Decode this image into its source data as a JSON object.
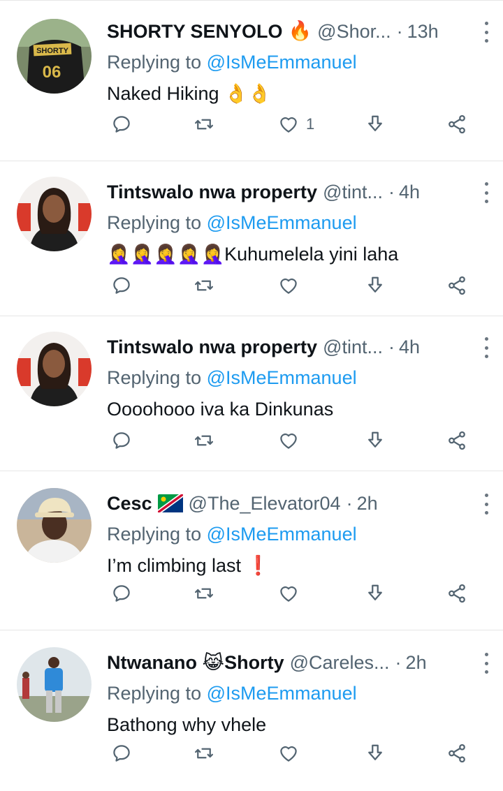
{
  "reply_prefix": "Replying to",
  "tweets": [
    {
      "name": "SHORTY SENYOLO",
      "name_emoji": "🔥",
      "handle": "@Shor...",
      "dot": "·",
      "time": "13h",
      "reply_to": "@IsMeEmmanuel",
      "text": "Naked Hiking ",
      "text_emoji": "👌👌",
      "like_count": "1",
      "avatar_text": "SHORTY",
      "avatar_number": "06"
    },
    {
      "name": "Tintswalo nwa property",
      "handle": "@tint...",
      "dot": "·",
      "time": "4h",
      "reply_to": "@IsMeEmmanuel",
      "text_emoji": "🤦‍♀️🤦‍♀️🤦‍♀️🤦‍♀️🤦‍♀️",
      "text": "Kuhumelela yini laha",
      "like_count": ""
    },
    {
      "name": "Tintswalo nwa property",
      "handle": "@tint...",
      "dot": "·",
      "time": "4h",
      "reply_to": "@IsMeEmmanuel",
      "text": "Oooohooo iva ka Dinkunas",
      "like_count": ""
    },
    {
      "name": "Cesc",
      "name_flag": "namibia-flag",
      "handle": "@The_Elevator04",
      "dot": "·",
      "time": "2h",
      "reply_to": "@IsMeEmmanuel",
      "text": "I’m climbing last ",
      "text_emoji": "❗",
      "like_count": ""
    },
    {
      "name": "Ntwanano ",
      "name_emoji": "😹",
      "name_suffix": "Shorty",
      "handle": "@Careles...",
      "dot": "·",
      "time": "2h",
      "reply_to": "@IsMeEmmanuel",
      "text": "Bathong why vhele",
      "like_count": ""
    }
  ],
  "colors": {
    "link": "#1d9bf0",
    "secondary": "#536471",
    "icon": "#536471",
    "divider": "#e6e6e6"
  },
  "icons": [
    "reply-icon",
    "retweet-icon",
    "like-icon",
    "download-icon",
    "share-icon",
    "more-icon"
  ]
}
